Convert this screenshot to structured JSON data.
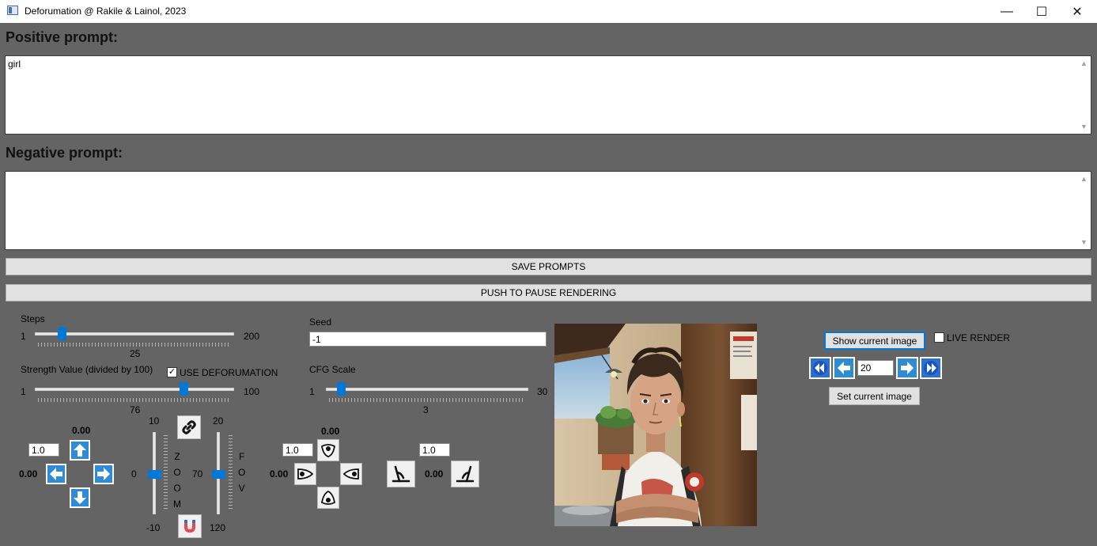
{
  "window": {
    "title": "Deforumation @ Rakile & Lainol, 2023",
    "minimize_glyph": "—",
    "maximize_glyph": "☐",
    "close_glyph": "✕"
  },
  "prompts": {
    "positive_title": "Positive prompt:",
    "positive_value": "girl",
    "negative_title": "Negative prompt:",
    "negative_value": "",
    "save_label": "SAVE PROMPTS",
    "pause_label": "PUSH TO PAUSE RENDERING"
  },
  "steps": {
    "label": "Steps",
    "min": "1",
    "max": "200",
    "value": "25",
    "fraction": 0.12
  },
  "strength": {
    "label": "Strength Value (divided by 100)",
    "min": "1",
    "max": "100",
    "value": "76",
    "fraction": 0.76,
    "use_deforumation_label": "USE DEFORUMATION",
    "use_deforumation_checked": true
  },
  "seed": {
    "label": "Seed",
    "value": "-1"
  },
  "cfg": {
    "label": "CFG Scale",
    "min": "1",
    "max": "30",
    "value": "3",
    "fraction": 0.07
  },
  "pan": {
    "step_value": "1.0",
    "x_value": "0.00",
    "y_value": "0.00"
  },
  "zoom": {
    "top": "10",
    "bottom": "-10",
    "value": "0",
    "letters": [
      "Z",
      "O",
      "O",
      "M"
    ],
    "fraction": 0.5
  },
  "fov": {
    "top": "20",
    "bottom": "120",
    "value": "70",
    "letters": [
      "F",
      "O",
      "V"
    ],
    "fraction": 0.5
  },
  "rotation": {
    "step_value": "1.0",
    "x_value": "0.00",
    "y_value": "0.00"
  },
  "tilt": {
    "step_value": "1.0",
    "value": "0.00"
  },
  "render_controls": {
    "show_current_label": "Show current image",
    "live_render_label": "LIVE RENDER",
    "live_render_checked": false,
    "frame_value": "20",
    "set_current_label": "Set current image"
  },
  "colors": {
    "background": "#646464",
    "accent": "#0078d7",
    "arrow_blue": "#2e8bd6"
  }
}
